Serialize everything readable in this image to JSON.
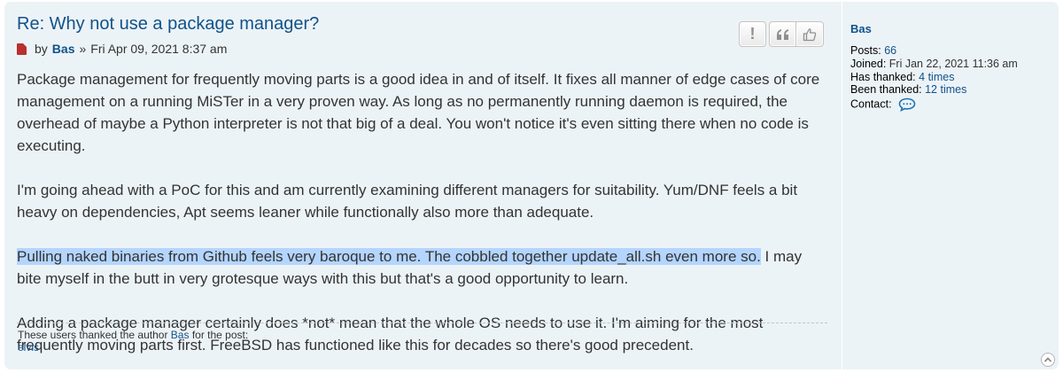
{
  "post": {
    "title": "Re: Why not use a package manager?",
    "by": "by",
    "author": "Bas",
    "separator": "»",
    "datetime": "Fri Apr 09, 2021 8:37 am",
    "buttons": {
      "report": "!",
      "quote": "quote-icon",
      "thanks": "thumbs-up-icon"
    },
    "paragraphs": {
      "p1": "Package management for frequently moving parts is a good idea in and of itself. It fixes all manner of edge cases of core management on a running MiSTer in a very proven way. As long as no permanently running daemon is required, the overhead of maybe a Python interpreter is not that big of a deal. You won't notice it's even sitting there when no code is executing.",
      "p2": "I'm going ahead with a PoC for this and am currently examining different managers for suitability. Yum/DNF feels a bit heavy on dependencies, Apt seems leaner while functionally also more than adequate.",
      "p3_highlighted": "Pulling naked binaries from Github feels very baroque to me. The cobbled together update_all.sh even more so.",
      "p3_rest": " I may bite myself in the butt in very grotesque ways with this but that's a good opportunity to learn.",
      "p4": "Adding a package manager certainly does *not* mean that the whole OS needs to use it. I'm aiming for the most frequently moving parts first. FreeBSD has functioned like this for decades so there's good precedent."
    },
    "thanks": {
      "prefix": "These users thanked the author",
      "author": "Bas",
      "suffix": "for the post:",
      "users": "elvis"
    }
  },
  "profile": {
    "username": "Bas",
    "posts_label": "Posts:",
    "posts_value": "66",
    "joined_label": "Joined:",
    "joined_value": "Fri Jan 22, 2021 11:36 am",
    "has_thanked_label": "Has thanked:",
    "has_thanked_value": "4 times",
    "been_thanked_label": "Been thanked:",
    "been_thanked_value": "12 times",
    "contact_label": "Contact:",
    "contact_icon": "speech-bubble-icon"
  },
  "colors": {
    "post_bg": "#ecf3f7",
    "link": "#105289",
    "highlight": "#b4d5fe",
    "post_icon": "#b8302f"
  }
}
